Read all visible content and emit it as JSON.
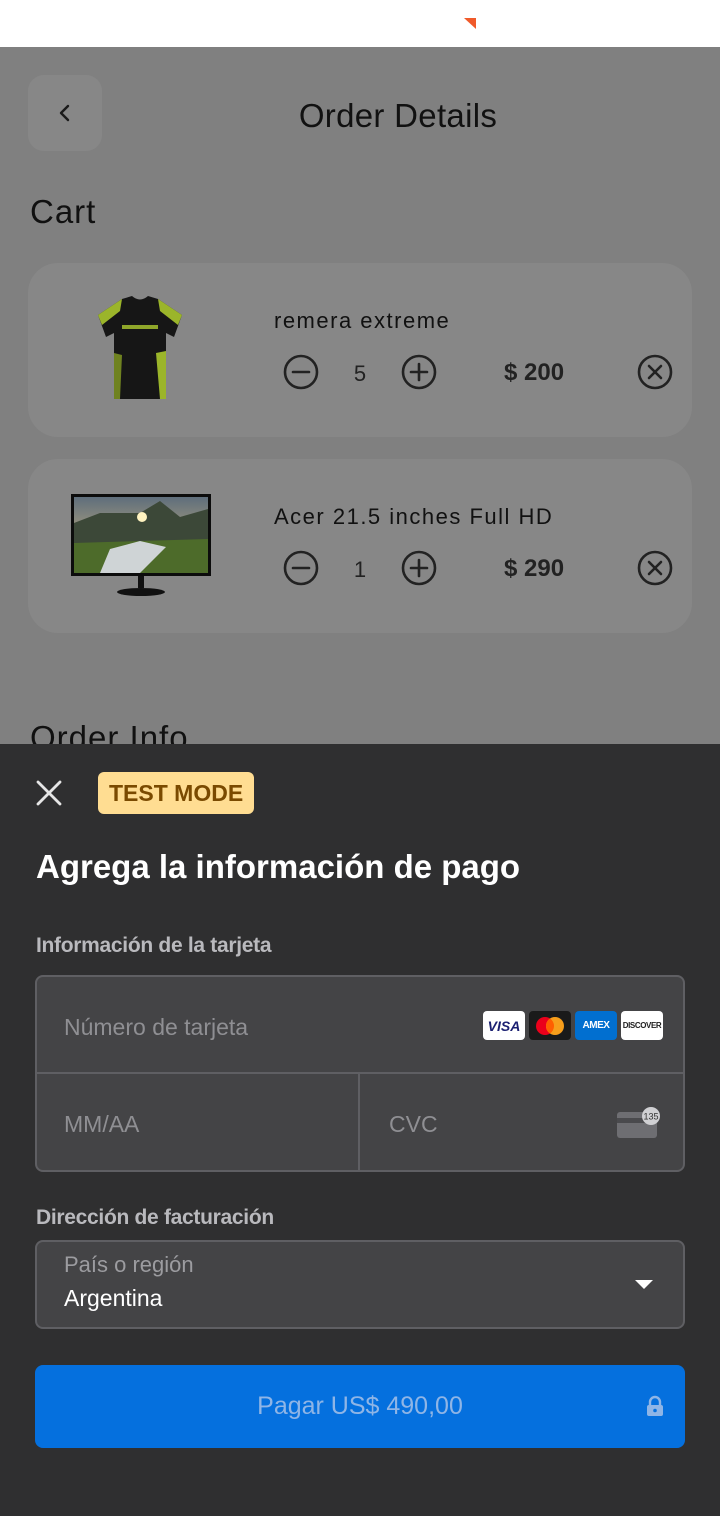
{
  "header": {
    "title": "Order Details"
  },
  "cart": {
    "title": "Cart",
    "items": [
      {
        "name": "remera extreme",
        "quantity": "5",
        "price": "$ 200"
      },
      {
        "name": "Acer 21.5 inches Full HD",
        "quantity": "1",
        "price": "$ 290"
      }
    ]
  },
  "order_info": {
    "title": "Order Info"
  },
  "payment": {
    "badge": "TEST MODE",
    "title": "Agrega la información de pago",
    "card_section_label": "Información de la tarjeta",
    "card_number_placeholder": "Número de tarjeta",
    "expiry_placeholder": "MM/AA",
    "cvc_placeholder": "CVC",
    "billing_label": "Dirección de facturación",
    "country_label": "País o región",
    "country_value": "Argentina",
    "pay_button": "Pagar US$ 490,00",
    "brands": [
      {
        "name": "visa",
        "text": "VISA"
      },
      {
        "name": "mastercard"
      },
      {
        "name": "amex",
        "text": "AMEX"
      },
      {
        "name": "discover",
        "text": "DISCOVER"
      }
    ],
    "cvc_icon_text": "135"
  },
  "colors": {
    "accent_blue": "#0570de",
    "sheet_bg": "#2f2f30",
    "badge_bg": "#ffdd92",
    "overlay_bg": "#808080"
  }
}
